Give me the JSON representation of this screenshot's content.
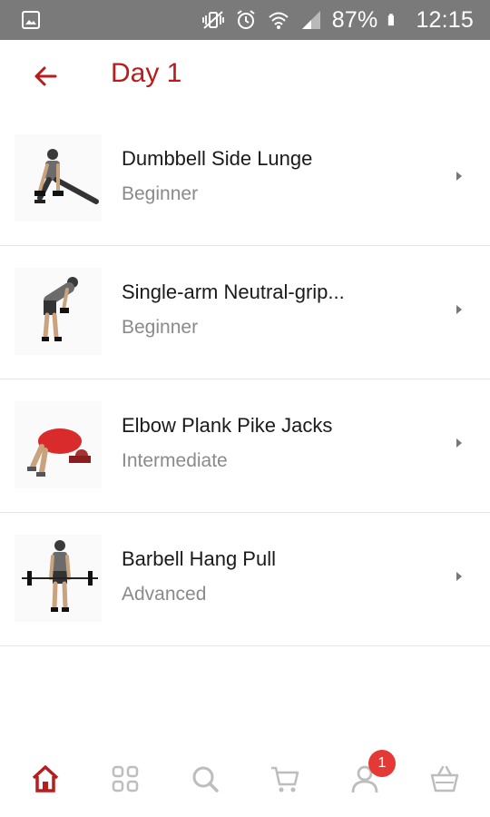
{
  "status_bar": {
    "battery": "87%",
    "time": "12:15"
  },
  "header": {
    "title": "Day 1"
  },
  "exercises": [
    {
      "name": "Dumbbell Side Lunge",
      "level": "Beginner"
    },
    {
      "name": "Single-arm Neutral-grip...",
      "level": "Beginner"
    },
    {
      "name": "Elbow Plank Pike Jacks",
      "level": "Intermediate"
    },
    {
      "name": "Barbell Hang Pull",
      "level": "Advanced"
    }
  ],
  "bottom_nav": {
    "profile_badge": "1",
    "active": "home",
    "accent_color": "#b81c1c"
  },
  "colors": {
    "accent": "#b81c1c",
    "status_bar": "#7a7a7a",
    "badge": "#e53935"
  }
}
